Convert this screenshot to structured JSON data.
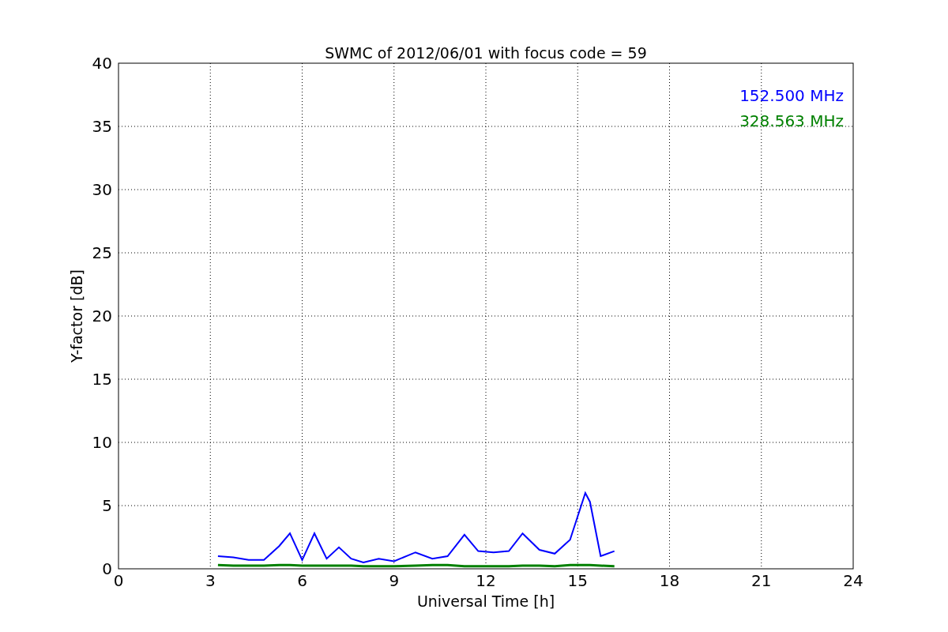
{
  "chart_data": {
    "type": "line",
    "title": "SWMC of 2012/06/01 with focus code = 59",
    "xlabel": "Universal Time [h]",
    "ylabel": "Y-factor [dB]",
    "x": [
      3.25,
      3.75,
      4.25,
      4.75,
      5.25,
      5.6,
      6.0,
      6.4,
      6.8,
      7.2,
      7.6,
      8.0,
      8.5,
      9.0,
      9.7,
      10.25,
      10.75,
      11.3,
      11.75,
      12.25,
      12.75,
      13.2,
      13.75,
      14.25,
      14.75,
      15.25,
      15.4,
      15.75,
      16.2
    ],
    "series": [
      {
        "name": "152.500 MHz",
        "color": "#0000ff",
        "values": [
          1.0,
          0.9,
          0.7,
          0.7,
          1.8,
          2.8,
          0.7,
          2.8,
          0.8,
          1.7,
          0.8,
          0.5,
          0.8,
          0.6,
          1.3,
          0.8,
          1.0,
          2.7,
          1.4,
          1.3,
          1.4,
          2.8,
          1.5,
          1.2,
          2.3,
          6.0,
          5.3,
          1.0,
          1.4
        ]
      },
      {
        "name": "328.563 MHz",
        "color": "#008000",
        "values": [
          0.3,
          0.25,
          0.25,
          0.25,
          0.3,
          0.3,
          0.25,
          0.25,
          0.25,
          0.25,
          0.25,
          0.2,
          0.2,
          0.2,
          0.25,
          0.3,
          0.3,
          0.2,
          0.2,
          0.2,
          0.2,
          0.25,
          0.25,
          0.2,
          0.3,
          0.3,
          0.3,
          0.25,
          0.2
        ]
      }
    ],
    "xlim": [
      0,
      24
    ],
    "ylim": [
      0,
      40
    ],
    "xticks": [
      0,
      3,
      6,
      9,
      12,
      15,
      18,
      21,
      24
    ],
    "yticks": [
      0,
      5,
      10,
      15,
      20,
      25,
      30,
      35,
      40
    ],
    "grid": true
  }
}
